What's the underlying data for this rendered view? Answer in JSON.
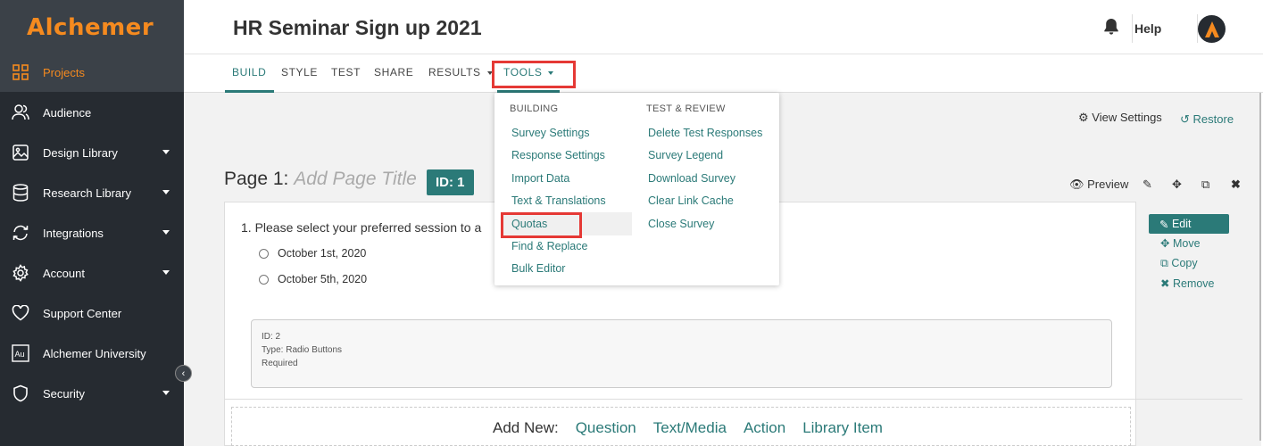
{
  "brand": {
    "logo_text": "Alchemer",
    "accent": "#f58a1f",
    "teal": "#2b7a78",
    "sidebar_bg": "#262b31"
  },
  "sidebar": {
    "items": [
      {
        "label": "Projects",
        "icon": "grid-icon",
        "active": true
      },
      {
        "label": "Audience",
        "icon": "users-icon"
      },
      {
        "label": "Design Library",
        "icon": "image-icon",
        "caret": true
      },
      {
        "label": "Research Library",
        "icon": "database-icon",
        "caret": true
      },
      {
        "label": "Integrations",
        "icon": "sync-icon",
        "caret": true
      },
      {
        "label": "Account",
        "icon": "gear-icon",
        "caret": true
      },
      {
        "label": "Support Center",
        "icon": "heart-icon"
      },
      {
        "label": "Alchemer University",
        "icon": "au-icon"
      },
      {
        "label": "Security",
        "icon": "shield-icon",
        "caret": true
      }
    ],
    "collapse_glyph": "‹"
  },
  "header": {
    "title": "HR Seminar Sign up 2021",
    "help": "Help"
  },
  "tabs": {
    "build": "BUILD",
    "style": "STYLE",
    "test": "TEST",
    "share": "SHARE",
    "results": "RESULTS",
    "tools": "TOOLS"
  },
  "toolbar": {
    "view_settings": "View Settings",
    "restore": "Restore",
    "preview": "Preview"
  },
  "page": {
    "prefix": "Page 1:",
    "title_placeholder": "Add Page Title",
    "id_badge": "ID: 1"
  },
  "question": {
    "title": "1. Please select your preferred session to a",
    "options": [
      "October 1st, 2020",
      "October 5th, 2020"
    ],
    "meta": {
      "id": "ID: 2",
      "type": "Type: Radio Buttons",
      "required": "Required"
    }
  },
  "actions": {
    "edit": "Edit",
    "move": "Move",
    "copy": "Copy",
    "remove": "Remove"
  },
  "add_new": {
    "label": "Add New:",
    "links": [
      "Question",
      "Text/Media",
      "Action",
      "Library Item"
    ]
  },
  "tools_menu": {
    "building": {
      "heading": "BUILDING",
      "items": [
        "Survey Settings",
        "Response Settings",
        "Import Data",
        "Text & Translations",
        "Quotas",
        "Find & Replace",
        "Bulk Editor"
      ]
    },
    "test_review": {
      "heading": "TEST & REVIEW",
      "items": [
        "Delete Test Responses",
        "Survey Legend",
        "Download Survey",
        "Clear Link Cache",
        "Close Survey"
      ]
    }
  }
}
